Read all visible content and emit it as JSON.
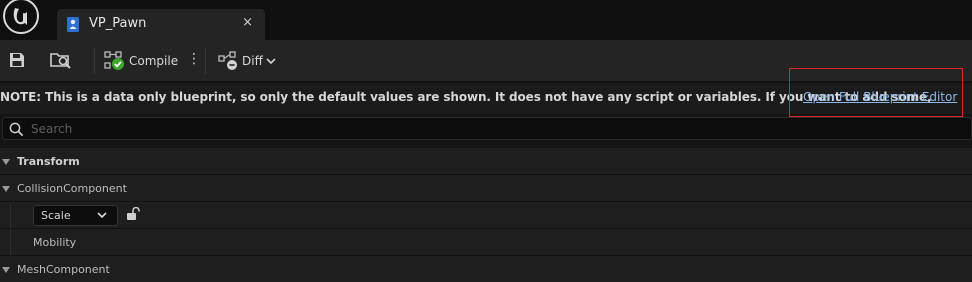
{
  "window": {
    "tab_title": "VP_Pawn",
    "tab_close_glyph": "×"
  },
  "toolbar": {
    "save_icon": "save-icon",
    "browse_icon": "browse-icon",
    "compile_label": "Compile",
    "kebab_glyph": "⋮",
    "diff_label": "Diff"
  },
  "notice": {
    "text": "NOTE: This is a data only blueprint, so only the default values are shown.  It does not have any script or variables.  If you want to add some,",
    "link_label": "Open Full Blueprint Editor"
  },
  "search": {
    "placeholder": "Search"
  },
  "details": {
    "sections": [
      {
        "label": "Transform"
      },
      {
        "label": "CollisionComponent"
      },
      {
        "label": "MeshComponent"
      }
    ],
    "scale_dropdown": {
      "value": "Scale"
    },
    "mobility_label": "Mobility"
  },
  "colors": {
    "accent_link": "#8bb6e8",
    "highlight_border": "#d9262a",
    "compile_ok": "#3ea52d"
  }
}
